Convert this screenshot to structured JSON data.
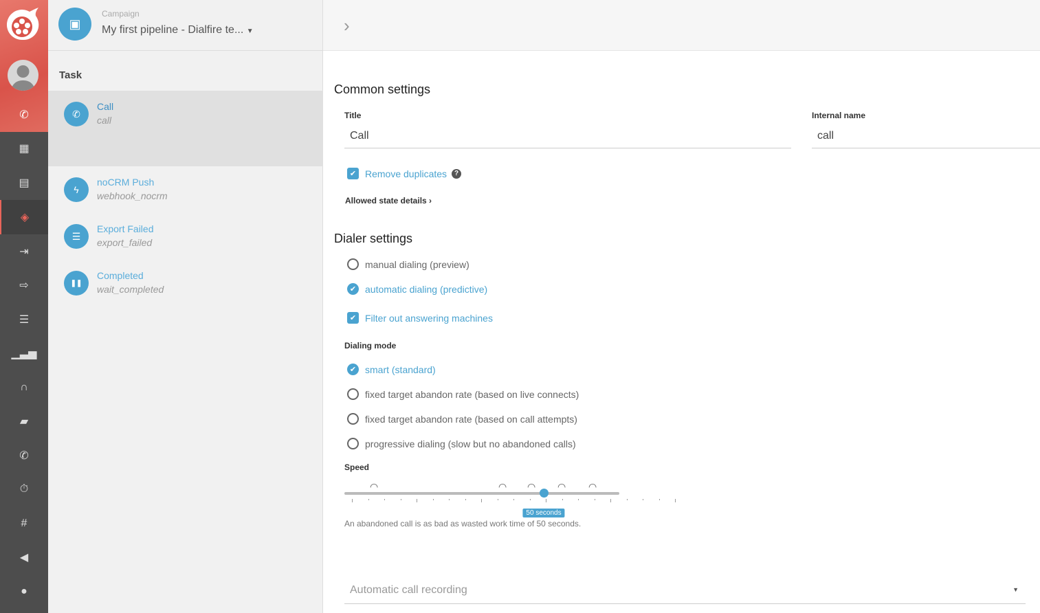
{
  "colors": {
    "accent": "#4aa3d0",
    "brand": "#d9534a",
    "nav_bg": "#4d4d4d"
  },
  "nav": {
    "items": [
      "phone-icon",
      "dashboard-icon",
      "archive-icon",
      "layers-icon",
      "data-import-icon",
      "data-export-icon",
      "database-icon",
      "bar-chart-icon",
      "headset-icon",
      "chat-stats-icon",
      "phone-icon",
      "stopwatch-icon",
      "phone-hash-icon",
      "chat-share-icon",
      "user-icon"
    ],
    "active": "layers-icon"
  },
  "campaign": {
    "label": "Campaign",
    "value": "My first pipeline - Dialfire te..."
  },
  "tasks": {
    "heading": "Task",
    "items": [
      {
        "title": "Call",
        "name": "call",
        "icon": "phone-icon"
      },
      {
        "title": "noCRM Push",
        "name": "webhook_nocrm",
        "icon": "bolt-icon"
      },
      {
        "title": "Export Failed",
        "name": "export_failed",
        "icon": "database-export-icon"
      },
      {
        "title": "Completed",
        "name": "wait_completed",
        "icon": "pause-icon"
      }
    ]
  },
  "common": {
    "heading": "Common settings",
    "title_label": "Title",
    "title_value": "Call",
    "internal_label": "Internal name",
    "internal_value": "call",
    "remove_duplicates": "Remove duplicates",
    "remove_duplicates_checked": true,
    "allowed_state": "Allowed state details"
  },
  "dialer": {
    "heading": "Dialer settings",
    "modes": [
      {
        "label": "manual dialing (preview)",
        "selected": false
      },
      {
        "label": "automatic dialing (predictive)",
        "selected": true
      }
    ],
    "filter_am": "Filter out answering machines",
    "filter_am_checked": true,
    "dialing_mode_label": "Dialing mode",
    "dialing_modes": [
      {
        "label": "smart (standard)",
        "selected": true
      },
      {
        "label": "fixed target abandon rate (based on live connects)",
        "selected": false
      },
      {
        "label": "fixed target abandon rate (based on call attempts)",
        "selected": false
      },
      {
        "label": "progressive dialing (slow but no abandoned calls)",
        "selected": false
      }
    ],
    "speed_label": "Speed",
    "speed_tooltip": "50 seconds",
    "speed_level_fraction": 0.725,
    "speed_text": "An abandoned call is as bad as wasted work time of 50 seconds."
  },
  "recording": {
    "placeholder": "Automatic call recording"
  }
}
